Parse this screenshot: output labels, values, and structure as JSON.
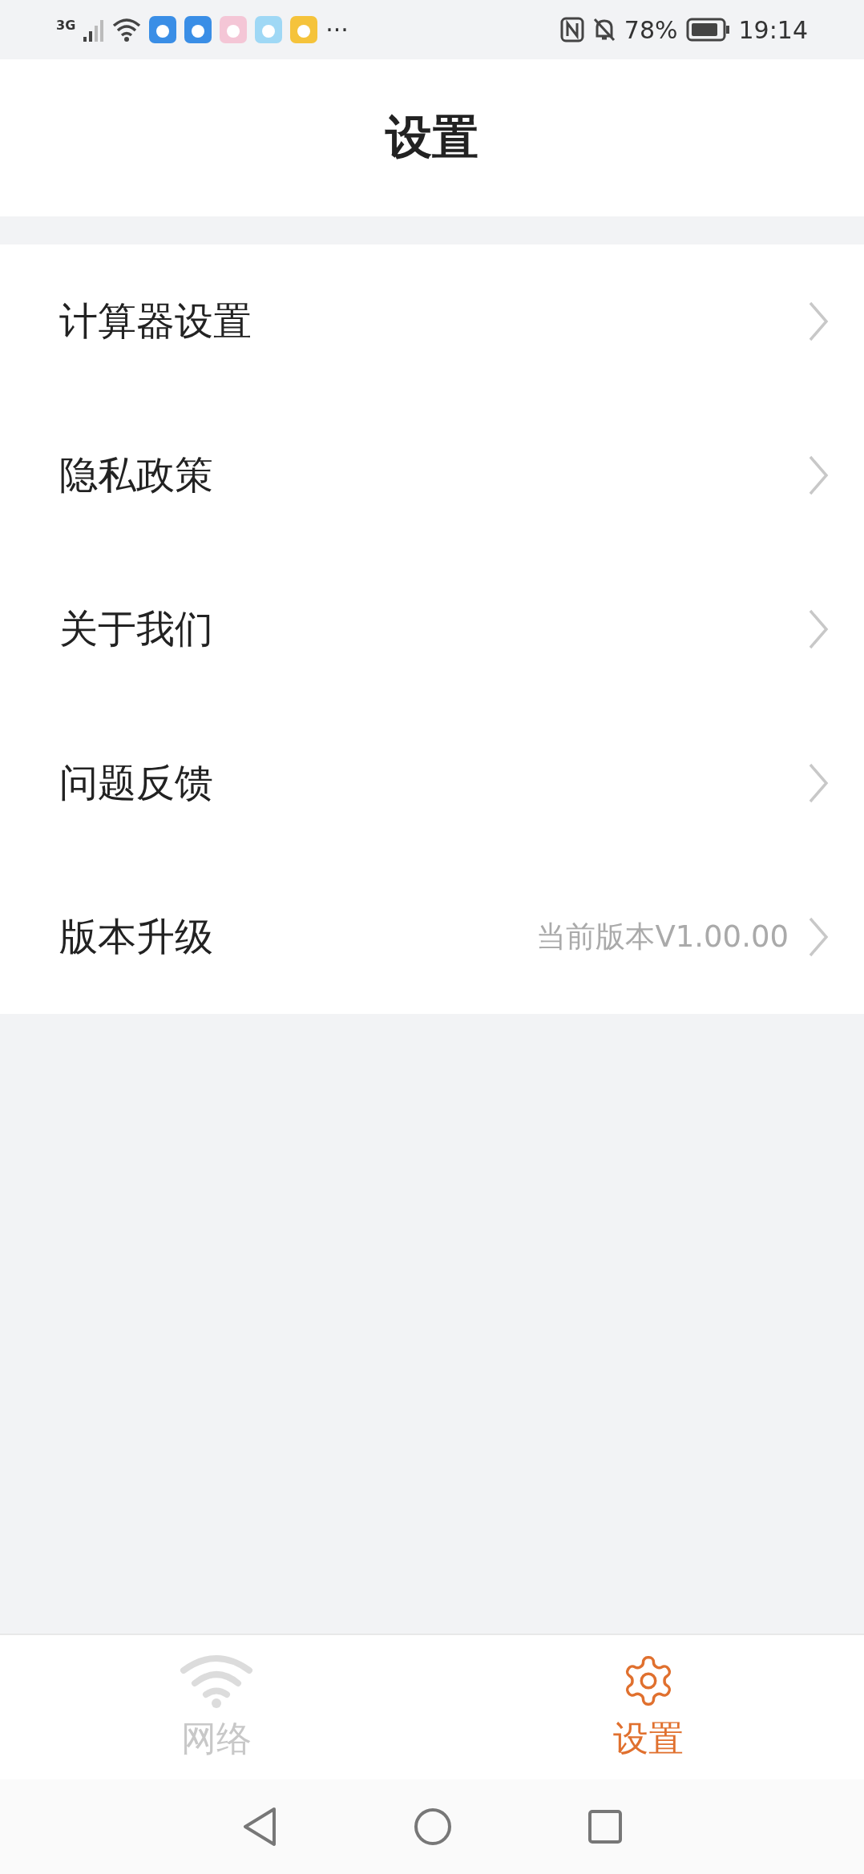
{
  "status_bar": {
    "network": "3G",
    "battery": "78%",
    "time": "19:14",
    "more": "···"
  },
  "header": {
    "title": "设置"
  },
  "menu": [
    {
      "label": "计算器设置"
    },
    {
      "label": "隐私政策"
    },
    {
      "label": "关于我们"
    },
    {
      "label": "问题反馈"
    },
    {
      "label": "版本升级",
      "value": "当前版本V1.00.00"
    }
  ],
  "tabs": [
    {
      "label": "网络",
      "kind": "wifi",
      "selected": false
    },
    {
      "label": "设置",
      "kind": "gear",
      "selected": true
    }
  ]
}
